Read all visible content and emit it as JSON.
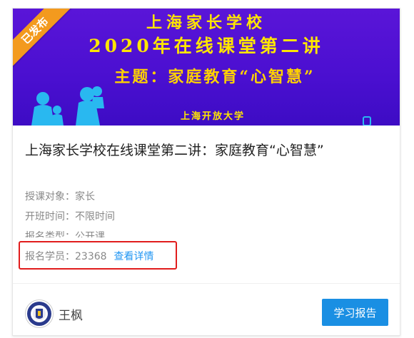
{
  "banner": {
    "title": "上海家长学校",
    "subtitle": "2020年在线课堂第二讲",
    "theme": "主题：家庭教育“心智慧”",
    "org": "上海开放大学",
    "status_ribbon": "已发布",
    "background_color": "#4a0fd0",
    "text_color": "#ffe600",
    "ribbon_color": "#f39a1e"
  },
  "course": {
    "title": "上海家长学校在线课堂第二讲：家庭教育“心智慧”",
    "audience": "授课对象：家长",
    "schedule": "开班时间：不限时间",
    "enroll_type": "报名类型：公开课",
    "enrolled_label": "报名学员：",
    "enrolled_count": "23368",
    "detail_link": "查看详情",
    "highlight_color": "#e11c1c"
  },
  "teacher": {
    "name": "王枫",
    "avatar_icon": "school-emblem-icon"
  },
  "actions": {
    "report_button": "学习报告",
    "button_color": "#1a8fe3",
    "link_color": "#2196f3"
  }
}
